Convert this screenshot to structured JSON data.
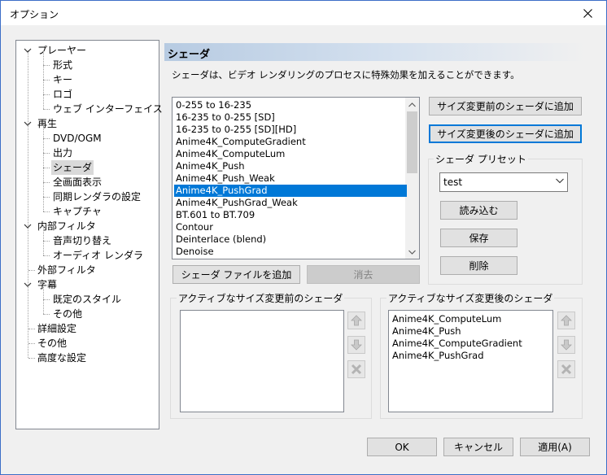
{
  "window": {
    "title": "オプション"
  },
  "tree": [
    {
      "label": "プレーヤー",
      "level": 0,
      "expander": true
    },
    {
      "label": "形式",
      "level": 1
    },
    {
      "label": "キー",
      "level": 1
    },
    {
      "label": "ロゴ",
      "level": 1
    },
    {
      "label": "ウェブ インターフェイス",
      "level": 1
    },
    {
      "label": "再生",
      "level": 0,
      "expander": true
    },
    {
      "label": "DVD/OGM",
      "level": 1
    },
    {
      "label": "出力",
      "level": 1
    },
    {
      "label": "シェーダ",
      "level": 1,
      "selected": true
    },
    {
      "label": "全画面表示",
      "level": 1
    },
    {
      "label": "同期レンダラの設定",
      "level": 1
    },
    {
      "label": "キャプチャ",
      "level": 1
    },
    {
      "label": "内部フィルタ",
      "level": 0,
      "expander": true
    },
    {
      "label": "音声切り替え",
      "level": 1
    },
    {
      "label": "オーディオ レンダラ",
      "level": 1
    },
    {
      "label": "外部フィルタ",
      "level": 0
    },
    {
      "label": "字幕",
      "level": 0,
      "expander": true
    },
    {
      "label": "既定のスタイル",
      "level": 1
    },
    {
      "label": "その他",
      "level": 1
    },
    {
      "label": "詳細設定",
      "level": 0
    },
    {
      "label": "その他",
      "level": 0
    },
    {
      "label": "高度な設定",
      "level": 0
    }
  ],
  "panel": {
    "title": "シェーダ",
    "description": "シェーダは、ビデオ レンダリングのプロセスに特殊効果を加えることができます。",
    "shaders": [
      "0-255 to 16-235",
      "16-235 to 0-255 [SD]",
      "16-235 to 0-255 [SD][HD]",
      "Anime4K_ComputeGradient",
      "Anime4K_ComputeLum",
      "Anime4K_Push",
      "Anime4K_Push_Weak",
      "Anime4K_PushGrad",
      "Anime4K_PushGrad_Weak",
      "BT.601 to BT.709",
      "Contour",
      "Deinterlace (blend)",
      "Denoise"
    ],
    "selected_shader": "Anime4K_PushGrad",
    "add_pre_button": "サイズ変更前のシェーダに追加",
    "add_post_button": "サイズ変更後のシェーダに追加",
    "preset_group": "シェーダ プリセット",
    "preset_value": "test",
    "load_button": "読み込む",
    "save_button": "保存",
    "delete_button": "削除",
    "add_file_button": "シェーダ ファイルを追加",
    "remove_button": "消去",
    "pre_group": "アクティブなサイズ変更前のシェーダ",
    "post_group": "アクティブなサイズ変更後のシェーダ",
    "pre_active": [],
    "post_active": [
      "Anime4K_ComputeLum",
      "Anime4K_Push",
      "Anime4K_ComputeGradient",
      "Anime4K_PushGrad"
    ]
  },
  "footer": {
    "ok": "OK",
    "cancel": "キャンセル",
    "apply": "適用(A)"
  },
  "colors": {
    "selection": "#0078d7",
    "header_gradient": "#b7cbe2"
  }
}
